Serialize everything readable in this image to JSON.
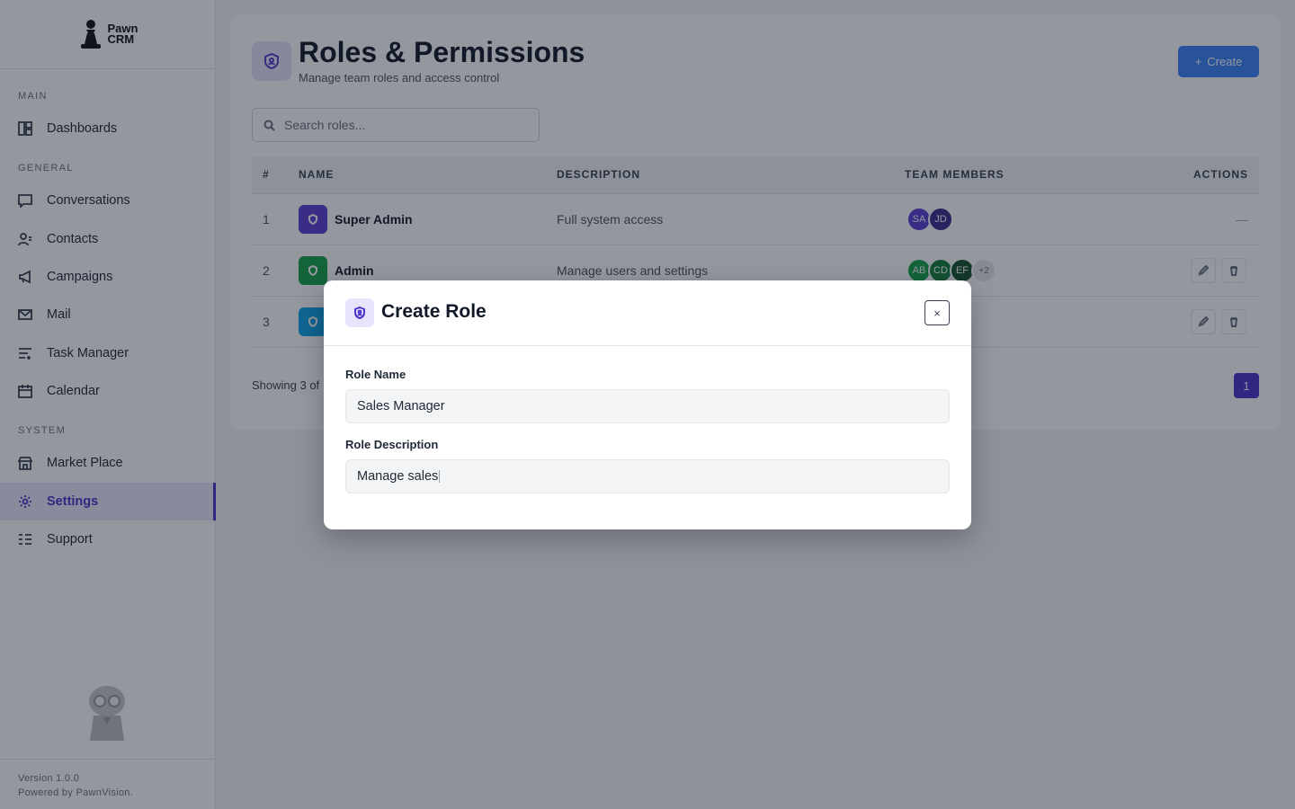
{
  "app": {
    "logo_line1": "Pawn",
    "logo_line2": "CRM"
  },
  "sidebar": {
    "sections": {
      "main": "MAIN",
      "general": "GENERAL",
      "system": "SYSTEM"
    },
    "items": [
      {
        "label": "Dashboards",
        "icon": "grid-icon"
      },
      {
        "label": "Conversations",
        "icon": "chat-icon"
      },
      {
        "label": "Contacts",
        "icon": "contacts-icon"
      },
      {
        "label": "Campaigns",
        "icon": "megaphone-icon"
      },
      {
        "label": "Mail",
        "icon": "mail-icon"
      },
      {
        "label": "Task Manager",
        "icon": "tasks-icon"
      },
      {
        "label": "Calendar",
        "icon": "calendar-icon"
      },
      {
        "label": "Market Place",
        "icon": "store-icon"
      },
      {
        "label": "Settings",
        "icon": "gear-icon",
        "active": true
      },
      {
        "label": "Support",
        "icon": "support-icon"
      }
    ],
    "version": "Version 1.0.0",
    "powered": "Powered by PawnVision."
  },
  "page": {
    "title": "Roles & Permissions",
    "subtitle": "Manage team roles and access control",
    "create_label": "Create",
    "search_placeholder": "Search roles..."
  },
  "table": {
    "headers": {
      "num": "#",
      "name": "NAME",
      "description": "DESCRIPTION",
      "members": "TEAM MEMBERS",
      "actions": "ACTIONS"
    },
    "rows": [
      {
        "num": "1",
        "name": "Super Admin",
        "description": "Full system access",
        "color": "#5b3fd1",
        "members": [
          "SA",
          "JD"
        ],
        "more": "",
        "actions": "—"
      },
      {
        "num": "2",
        "name": "Admin",
        "description": "Manage users and settings",
        "color": "#16a34a",
        "members": [
          "AB",
          "CD",
          "EF"
        ],
        "more": "+2",
        "actions": ""
      },
      {
        "num": "3",
        "name": "",
        "description": "",
        "color": "#0ea5e9",
        "members": [],
        "more": "",
        "actions": ""
      }
    ],
    "showing": "Showing 3 of",
    "page": "1"
  },
  "modal": {
    "title": "Create Role",
    "close": "×",
    "role_name_label": "Role Name",
    "role_name_value": "Sales Manager",
    "role_desc_label": "Role Description",
    "role_desc_value": "Manage sales"
  },
  "colors": {
    "accent": "#4c32c8",
    "create_button": "#3b82f6"
  }
}
